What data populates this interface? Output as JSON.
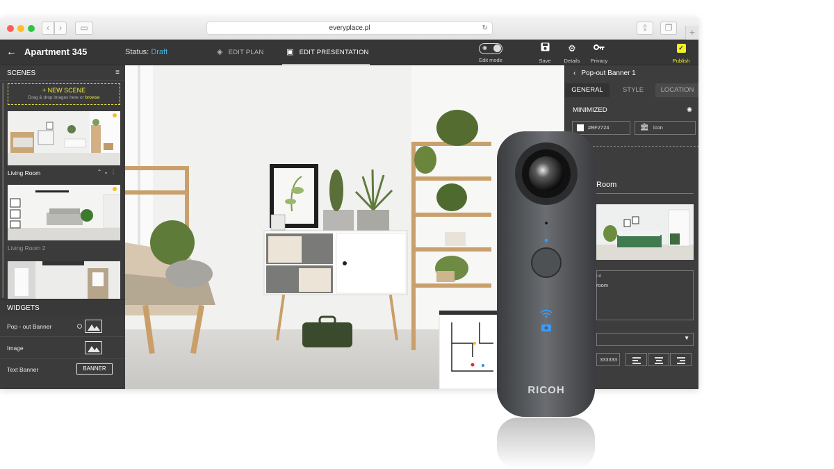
{
  "browser": {
    "url": "everyplace.pl"
  },
  "header": {
    "project_title": "Apartment 345",
    "status_label": "Status:",
    "status_value": "Draft",
    "tabs": [
      {
        "label": "EDIT PLAN"
      },
      {
        "label": "EDIT PRESENTATION"
      }
    ],
    "tools": [
      {
        "label": "Edit mode",
        "icon": "toggle-icon"
      },
      {
        "label": "Save",
        "icon": "save-icon"
      },
      {
        "label": "Details",
        "icon": "gear-icon"
      },
      {
        "label": "Privacy",
        "icon": "key-icon"
      },
      {
        "label": "Publish",
        "icon": "publish-icon"
      }
    ],
    "publish_color": "#f3ef22",
    "status_color": "#41b4d9"
  },
  "sidebar": {
    "scenes_title": "SCENES",
    "new_scene_label": "+ NEW SCENE",
    "new_scene_hint": "Drag & drop images here or",
    "new_scene_link": "browse",
    "scenes": [
      {
        "label": "Living Room"
      },
      {
        "label": "Living Room 2"
      }
    ],
    "widgets_title": "WIDGETS",
    "widgets": [
      {
        "label": "Pop - out Banner",
        "icon": "image-icon"
      },
      {
        "label": "Image",
        "icon": "image-icon"
      },
      {
        "label": "Text Banner",
        "button": "BANNER"
      }
    ]
  },
  "right_panel": {
    "title": "Pop-out Banner 1",
    "tabs": [
      "GENERAL",
      "STYLE",
      "LOCATION"
    ],
    "section": "MINIMIZED",
    "color_value": "#BF2724",
    "icon_value": "icon",
    "room_label": "Room",
    "textarea_label": "nd",
    "textarea_value": "room",
    "hex_value": "333333"
  },
  "camera": {
    "brand": "RICOH"
  }
}
